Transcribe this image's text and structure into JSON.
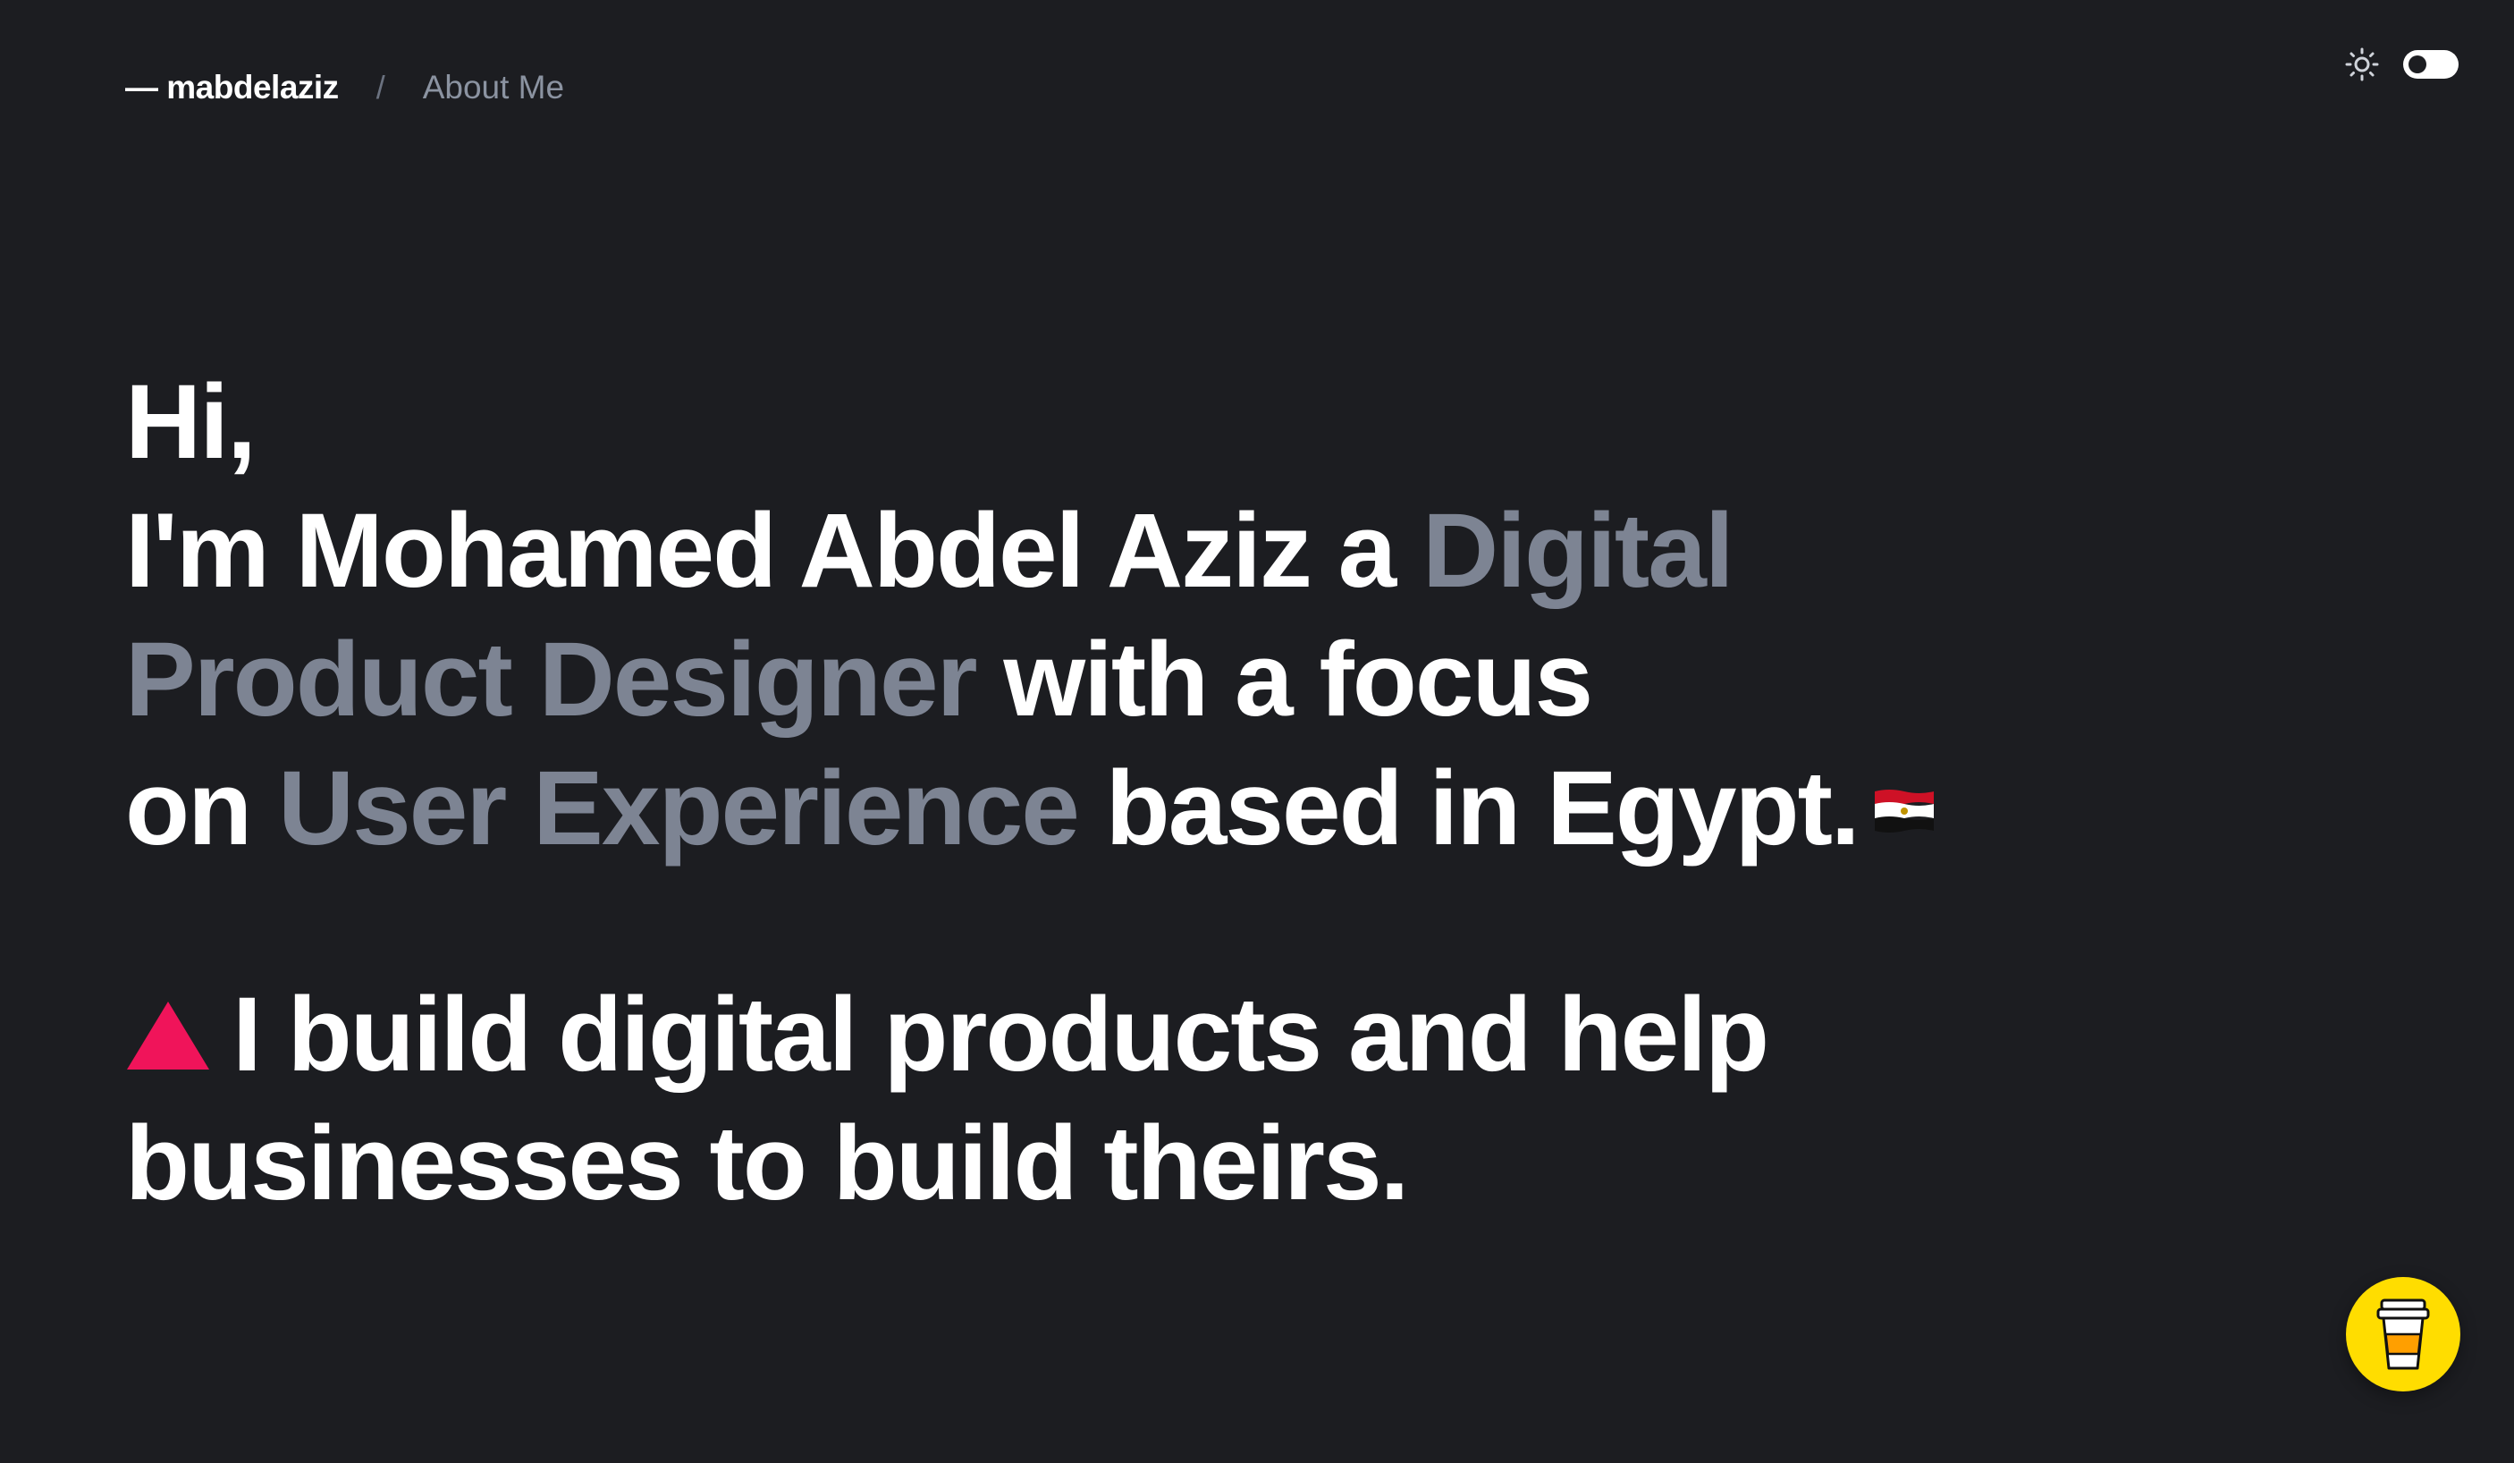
{
  "header": {
    "brand": "— mabdelaziz",
    "separator": "/",
    "breadcrumb": "About Me"
  },
  "theme": {
    "icon": "sun-icon",
    "toggle_state": "dark"
  },
  "hero": {
    "line1": "Hi,",
    "line2_a": "I'm Mohamed Abdel Aziz a ",
    "line2_b": "Digital",
    "line3_a": "Product Designer",
    "line3_b": " with a focus",
    "line4_a": "on ",
    "line4_b": "User Experience",
    "line4_c": " based in Egypt.",
    "flag": "egypt-flag-icon"
  },
  "tagline": {
    "icon": "triangle-icon",
    "line1": "I build digital products and help",
    "line2": "businesses to build theirs."
  },
  "floating_button": {
    "icon": "coffee-cup-icon"
  },
  "colors": {
    "background": "#1c1d21",
    "text": "#ffffff",
    "muted": "#7d8493",
    "accent": "#f0145a",
    "coffee": "#ffdd00"
  }
}
